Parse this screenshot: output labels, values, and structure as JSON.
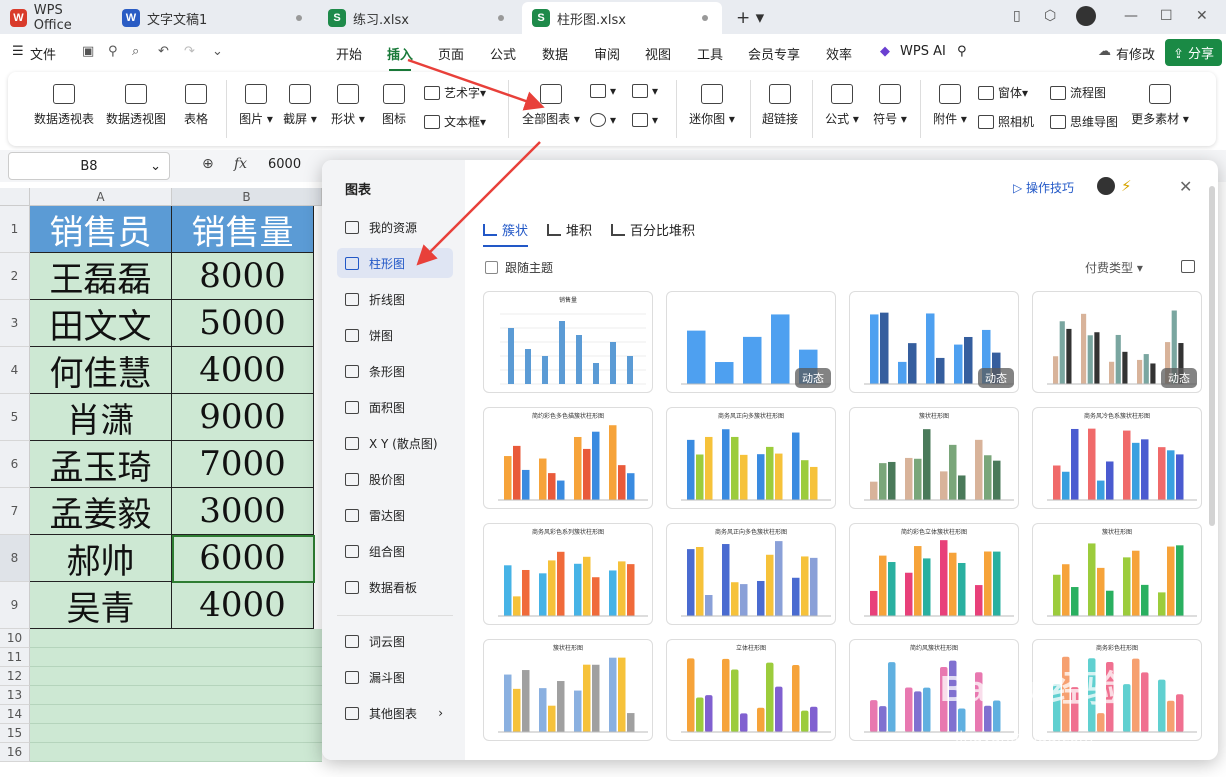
{
  "tabs": [
    {
      "label": "WPS Office",
      "icon": "W",
      "color": "#d93b2b"
    },
    {
      "label": "文字文稿1",
      "icon": "W",
      "color": "#2a5cc4"
    },
    {
      "label": "练习.xlsx",
      "icon": "S",
      "color": "#1e8a4a"
    },
    {
      "label": "柱形图.xlsx",
      "icon": "S",
      "color": "#1e8a4a"
    }
  ],
  "menu": {
    "file": "文件",
    "items": [
      "开始",
      "插入",
      "页面",
      "公式",
      "数据",
      "审阅",
      "视图",
      "工具",
      "会员专享",
      "效率"
    ],
    "wps_ai": "WPS AI",
    "modify": "有修改",
    "share": "分享"
  },
  "ribbon": {
    "large": [
      "数据透视表",
      "数据透视图",
      "表格",
      "图片",
      "截屏",
      "形状",
      "图标",
      "全部图表",
      "迷你图",
      "超链接",
      "公式",
      "符号",
      "附件",
      "更多素材"
    ],
    "small": [
      "艺术字",
      "文本框",
      "窗体",
      "照相机",
      "流程图",
      "思维导图"
    ]
  },
  "formula": {
    "cell": "B8",
    "fx": "fx",
    "value": "6000"
  },
  "sheet": {
    "col_a": "A",
    "col_b": "B",
    "header": [
      "销售员",
      "销售量"
    ],
    "rows": [
      [
        "王磊磊",
        "8000"
      ],
      [
        "田文文",
        "5000"
      ],
      [
        "何佳慧",
        "4000"
      ],
      [
        "肖潇",
        "9000"
      ],
      [
        "孟玉琦",
        "7000"
      ],
      [
        "孟姜毅",
        "3000"
      ],
      [
        "郝帅",
        "6000"
      ],
      [
        "吴青",
        "4000"
      ]
    ],
    "row_numbers": [
      "1",
      "2",
      "3",
      "4",
      "5",
      "6",
      "7",
      "8",
      "9",
      "10",
      "11",
      "12",
      "13",
      "14",
      "15",
      "16"
    ]
  },
  "panel": {
    "title": "图表",
    "categories": [
      "我的资源",
      "柱形图",
      "折线图",
      "饼图",
      "条形图",
      "面积图",
      "X Y (散点图)",
      "股价图",
      "雷达图",
      "组合图",
      "数据看板"
    ],
    "extras": [
      "词云图",
      "漏斗图",
      "其他图表"
    ],
    "tips": "操作技巧",
    "subtabs": [
      "簇状",
      "堆积",
      "百分比堆积"
    ],
    "follow_theme": "跟随主题",
    "pay_type": "付费类型",
    "badge": "动态",
    "card_titles": [
      "销售量",
      "",
      "",
      "",
      "简约彩色多色描簇状柱形图",
      "商务风正向多簇状柱形图",
      "簇状柱形图",
      "商务风冷色系簇状柱形图",
      "商务风彩色系列簇状柱形图",
      "商务风正向多色簇状柱形图",
      "简约彩色立体簇状柱形图",
      "簇状柱形图",
      "簇状柱形图",
      "立体柱形图",
      "简约风簇状柱形图",
      "商务彩色柱形图"
    ]
  },
  "chart_data": {
    "type": "bar",
    "title": "销售量",
    "categories": [
      "王磊磊",
      "田文文",
      "何佳慧",
      "肖潇",
      "孟玉琦",
      "孟姜毅",
      "郝帅",
      "吴青"
    ],
    "values": [
      8000,
      5000,
      4000,
      9000,
      7000,
      3000,
      6000,
      4000
    ],
    "ylim": [
      0,
      10000
    ]
  },
  "colors": {
    "accent": "#2258c7",
    "green": "#1a7a3a",
    "header_cell": "#5b9bd5",
    "cell_fill": "#cde8d3",
    "arrow": "#e8403a"
  }
}
